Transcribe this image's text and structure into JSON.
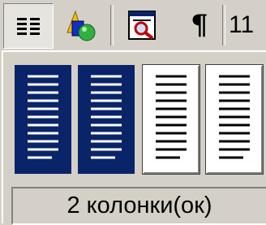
{
  "toolbar": {
    "buttons": [
      {
        "name": "columns-icon",
        "pressed": true
      },
      {
        "name": "drawing-icon",
        "pressed": false
      },
      {
        "name": "document-map-icon",
        "pressed": false
      },
      {
        "name": "show-formatting-icon",
        "pressed": false
      }
    ],
    "pilcrow": "¶",
    "font_size": "11"
  },
  "columns_palette": {
    "options": [
      {
        "columns": 1,
        "selected": true
      },
      {
        "columns": 2,
        "selected": true
      },
      {
        "columns": 3,
        "selected": false
      },
      {
        "columns": 4,
        "selected": false
      }
    ],
    "status_text": "2 колонки(ок)"
  },
  "colors": {
    "selection": "#0a246a",
    "face": "#d4d0c8"
  }
}
